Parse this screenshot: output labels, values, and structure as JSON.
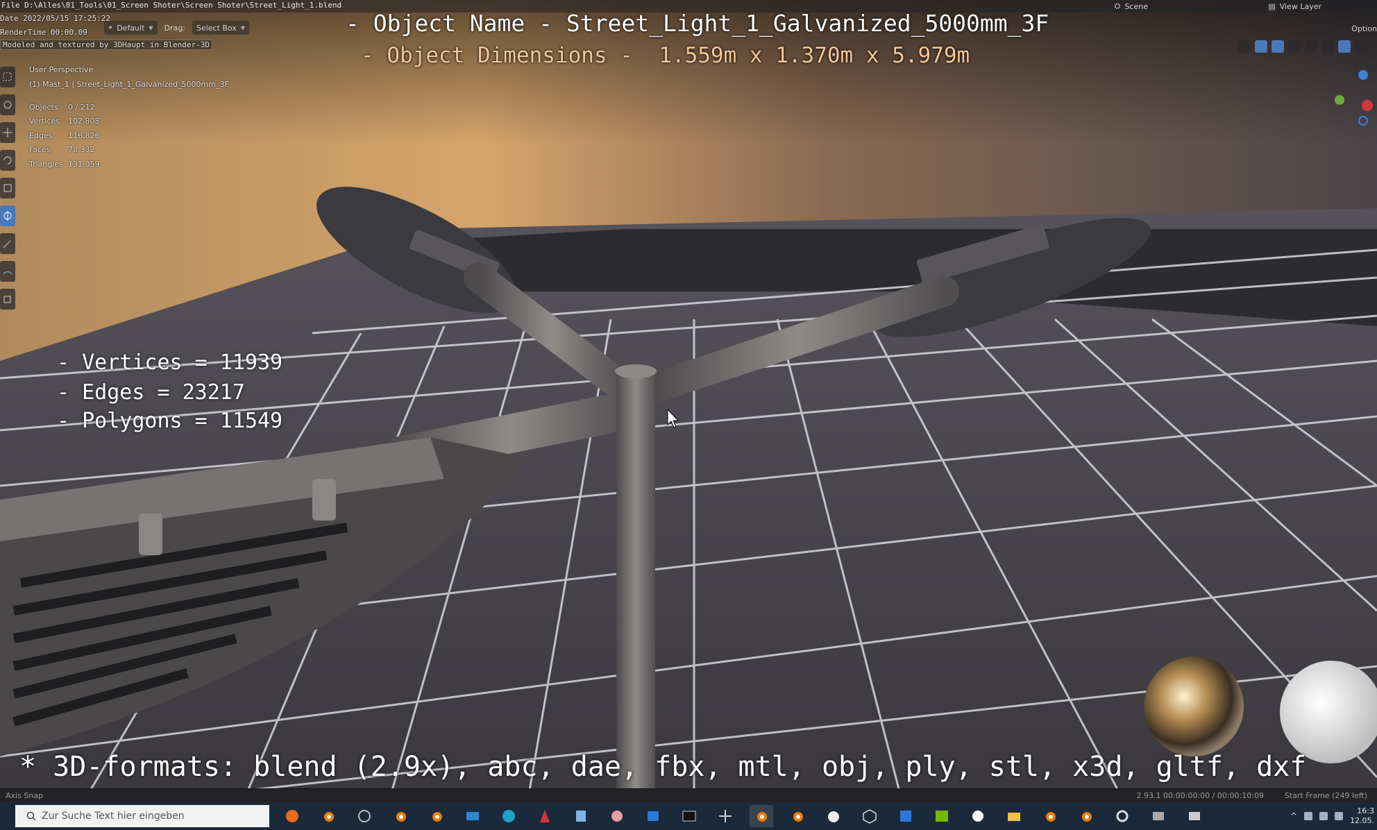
{
  "header": {
    "file_path": "File D:\\Alles\\01_Tools\\01_Screen Shoter\\Screen Shoter\\Street_Light_1.blend",
    "date": "Date 2022/05/15 17:25:22",
    "rendertime": "RenderTime 00:00.09",
    "credit": "Modeled and textured by 3DHaupt in Blender-3D",
    "scene_label": "Scene",
    "view_layer_label": "View Layer",
    "options_label": "Option"
  },
  "toolbar": {
    "orientation_value": "Default",
    "drag_label": "Drag:",
    "drag_value": "Select Box"
  },
  "overlay": {
    "object_name": "- Object Name - Street_Light_1_Galvanized_5000mm_3F",
    "object_dimensions": "- Object Dimensions -  1.559m x 1.370m x 5.979m"
  },
  "viewport_info": {
    "perspective": "User Perspective",
    "object_line": "(1) Mast_1 | Street_Light_1_Galvanized_5000mm_3F",
    "stats": [
      {
        "label": "Objects",
        "value": "0 / 212"
      },
      {
        "label": "Vertices",
        "value": "102,808"
      },
      {
        "label": "Edges",
        "value": "116,826"
      },
      {
        "label": "Faces",
        "value": "78,332"
      },
      {
        "label": "Triangles",
        "value": "131,059"
      }
    ]
  },
  "mesh_stats": {
    "vertices": "- Vertices = 11939",
    "edges": "- Edges = 23217",
    "polygons": "- Polygons = 11549"
  },
  "formats_caption": "* 3D-formats: blend (2.9x), abc, dae, fbx, mtl, obj, ply, stl, x3d, gltf, dxf",
  "statusbar": {
    "left": "Axis Snap",
    "version": "2.93.1  00:00:00:00 / 00:00:10:09",
    "frame": "Start Frame (249 left)"
  },
  "taskbar": {
    "search_placeholder": "Zur Suche Text hier eingeben",
    "clock_time": "16:3",
    "clock_date": "12.05."
  },
  "colors": {
    "accent_blue": "#4b78b8",
    "dimension_text": "#f4c79a",
    "taskbar": "#1b2a3a"
  }
}
